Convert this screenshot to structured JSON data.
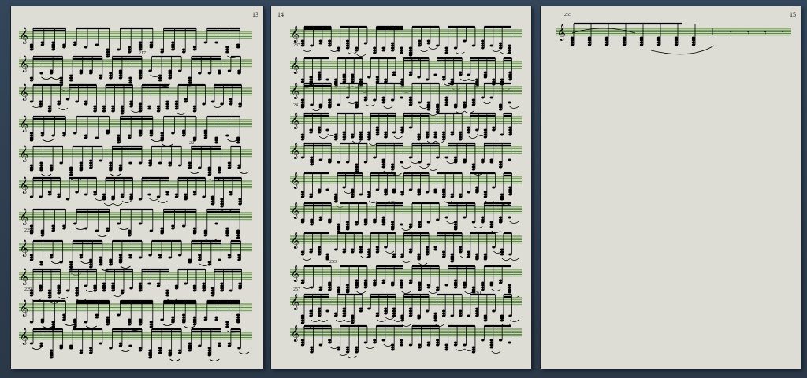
{
  "pages": [
    {
      "page_number": "13",
      "measure_numbers": [
        "217",
        "221",
        "225",
        "229"
      ]
    },
    {
      "page_number": "14",
      "measure_numbers": [
        "237",
        "241",
        "249",
        "253",
        "257",
        "261"
      ]
    },
    {
      "page_number": "15",
      "measure_numbers": [
        "265"
      ]
    }
  ],
  "colors": {
    "background": "#2f3e4e",
    "page": "#ddddd6",
    "staff_highlight": "#b7d49a"
  }
}
